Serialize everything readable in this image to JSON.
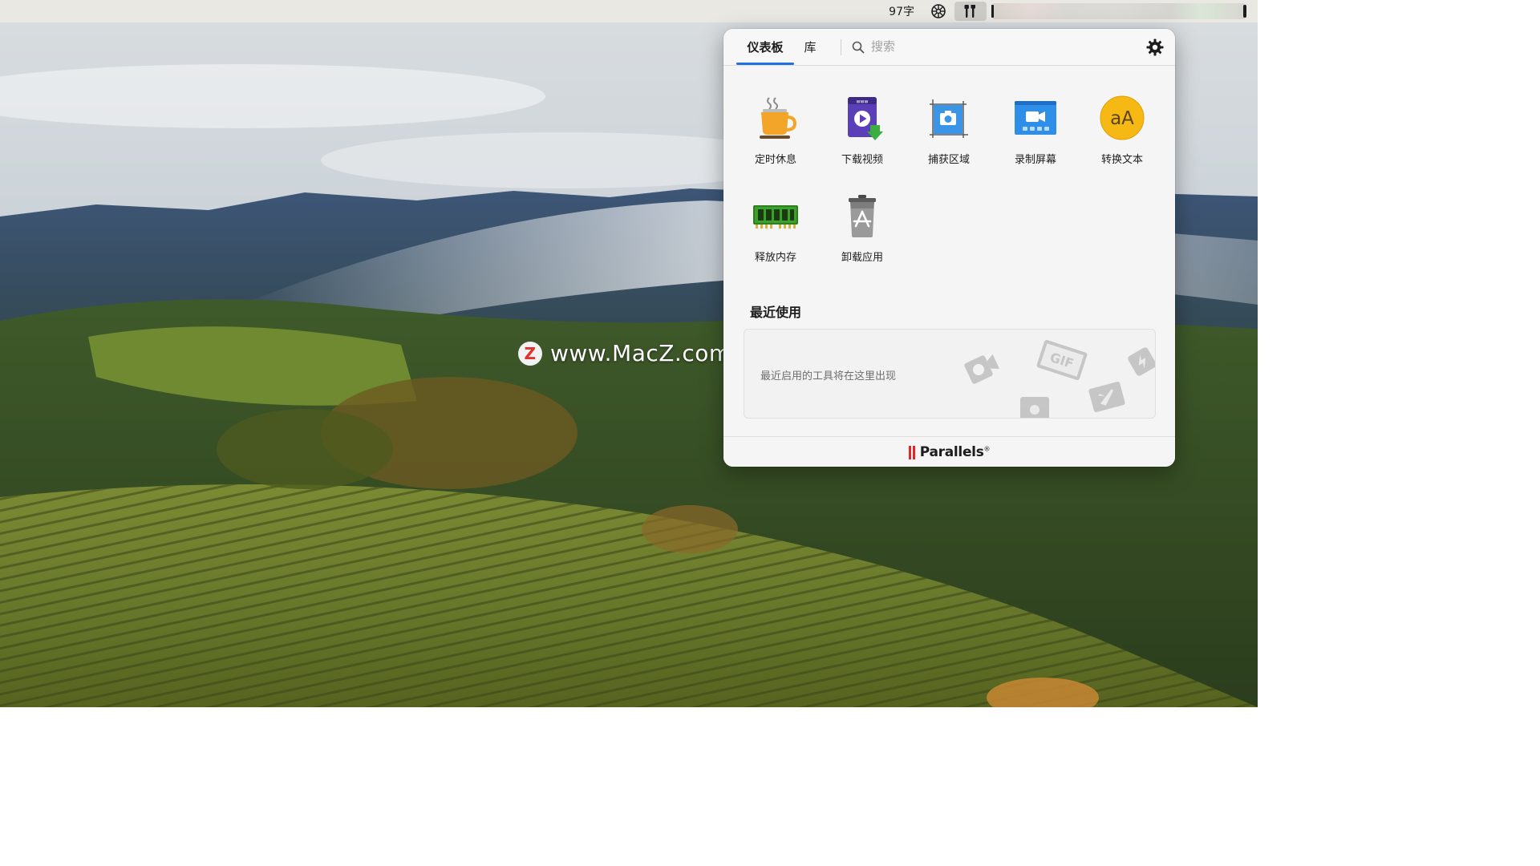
{
  "menubar": {
    "word_count": "97字",
    "icons": [
      "app-icon",
      "toolbox-icon"
    ],
    "blurred_area": "status-icons"
  },
  "watermark": {
    "badge": "Z",
    "text": "www.MacZ.com"
  },
  "panel": {
    "tabs": [
      {
        "label": "仪表板",
        "active": true
      },
      {
        "label": "库",
        "active": false
      }
    ],
    "search": {
      "placeholder": "搜索",
      "value": ""
    },
    "settings_icon": "gear-icon",
    "tools": [
      {
        "label": "定时休息",
        "icon": "coffee-cup-icon"
      },
      {
        "label": "下载视频",
        "icon": "download-video-icon"
      },
      {
        "label": "捕获区域",
        "icon": "capture-area-icon"
      },
      {
        "label": "录制屏幕",
        "icon": "record-screen-icon"
      },
      {
        "label": "转换文本",
        "icon": "convert-text-icon",
        "glyph": "aA"
      },
      {
        "label": "释放内存",
        "icon": "memory-icon"
      },
      {
        "label": "卸载应用",
        "icon": "uninstall-app-icon"
      }
    ],
    "recent": {
      "title": "最近使用",
      "empty_text": "最近启用的工具将在这里出现",
      "art_labels": {
        "gif": "GIF"
      }
    },
    "footer": {
      "brand": "Parallels",
      "reg": "®"
    }
  },
  "colors": {
    "accent": "#1f6fe5",
    "panel_bg": "#f5f5f5",
    "parallels_red": "#e1262a",
    "convert_text_yellow": "#f6b914"
  }
}
